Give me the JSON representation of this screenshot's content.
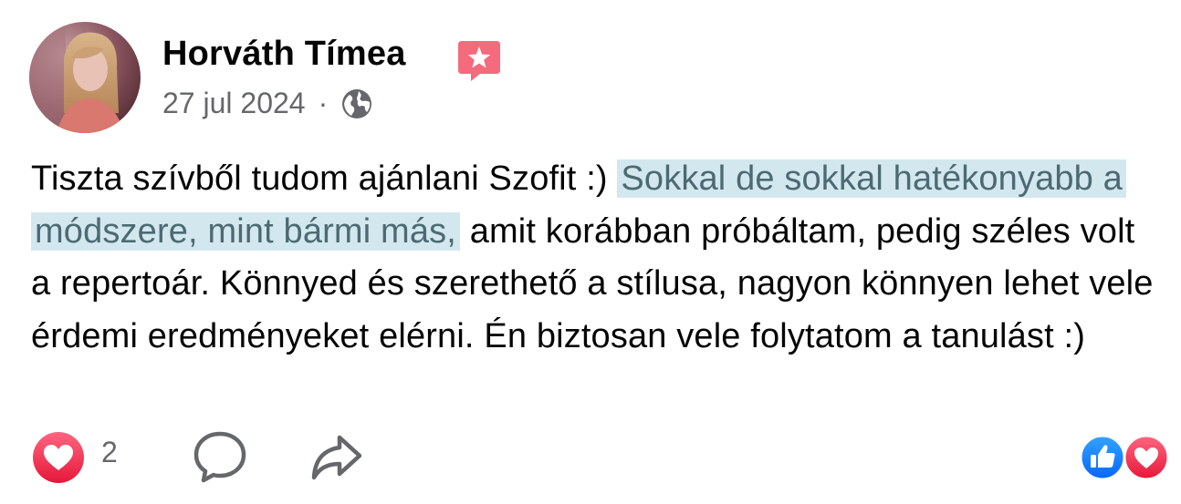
{
  "post": {
    "author": "Horváth Tímea",
    "date": "27 jul 2024",
    "separator": "·",
    "audience_icon": "globe-icon",
    "badge_icon": "star-badge-icon",
    "text_before": "Tiszta szívből tudom ajánlani Szofit :) ",
    "text_highlight": "Sokkal de sokkal hatékonyabb a módszere, mint bármi más,",
    "text_after": " amit korábban próbáltam, pedig széles volt a repertoár. Könnyed és szerethető a stílusa, nagyon könnyen lehet vele érdemi eredményeket elérni. Én biztosan vele folytatom a tanulást :)",
    "highlight_color": "#d3e8ee",
    "highlight_text_color": "#4d6a73"
  },
  "footer": {
    "love_count": "2",
    "love_icon": "heart-reaction-icon",
    "comment_icon": "comment-icon",
    "share_icon": "share-icon",
    "summary_icons": [
      "like-icon",
      "heart-icon"
    ],
    "like_color": "#1877f2",
    "love_color": "#f33e58"
  }
}
